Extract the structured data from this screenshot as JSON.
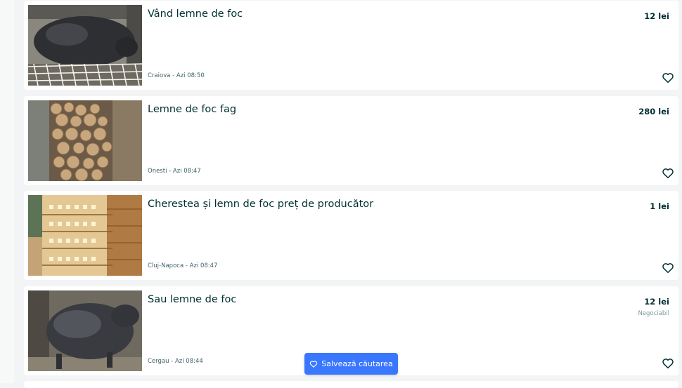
{
  "listings": [
    {
      "title": "Vând lemne de foc",
      "price": "12 lei",
      "negotiable": "",
      "location_date": "Craiova - Azi 08:50",
      "image": "black-pig-photo",
      "favorite_icon": "heart-icon"
    },
    {
      "title": "Lemne de foc fag",
      "price": "280 lei",
      "negotiable": "",
      "location_date": "Onesti - Azi 08:47",
      "image": "stacked-firewood-photo",
      "favorite_icon": "heart-icon"
    },
    {
      "title": "Cherestea și lemn de foc preț de producător",
      "price": "1 lei",
      "negotiable": "",
      "location_date": "Cluj-Napoca - Azi 08:47",
      "image": "lumber-stacks-photo",
      "favorite_icon": "heart-icon"
    },
    {
      "title": "Sau lemne de foc",
      "price": "12 lei",
      "negotiable": "Negociabil",
      "location_date": "Cergau - Azi 08:44",
      "image": "black-pig-photo",
      "favorite_icon": "heart-icon"
    }
  ],
  "save_search": {
    "label": "Salvează căutarea",
    "icon": "heart-icon"
  },
  "colors": {
    "accent": "#3a77ff",
    "text": "#002f34",
    "background": "#f2f4f5"
  }
}
